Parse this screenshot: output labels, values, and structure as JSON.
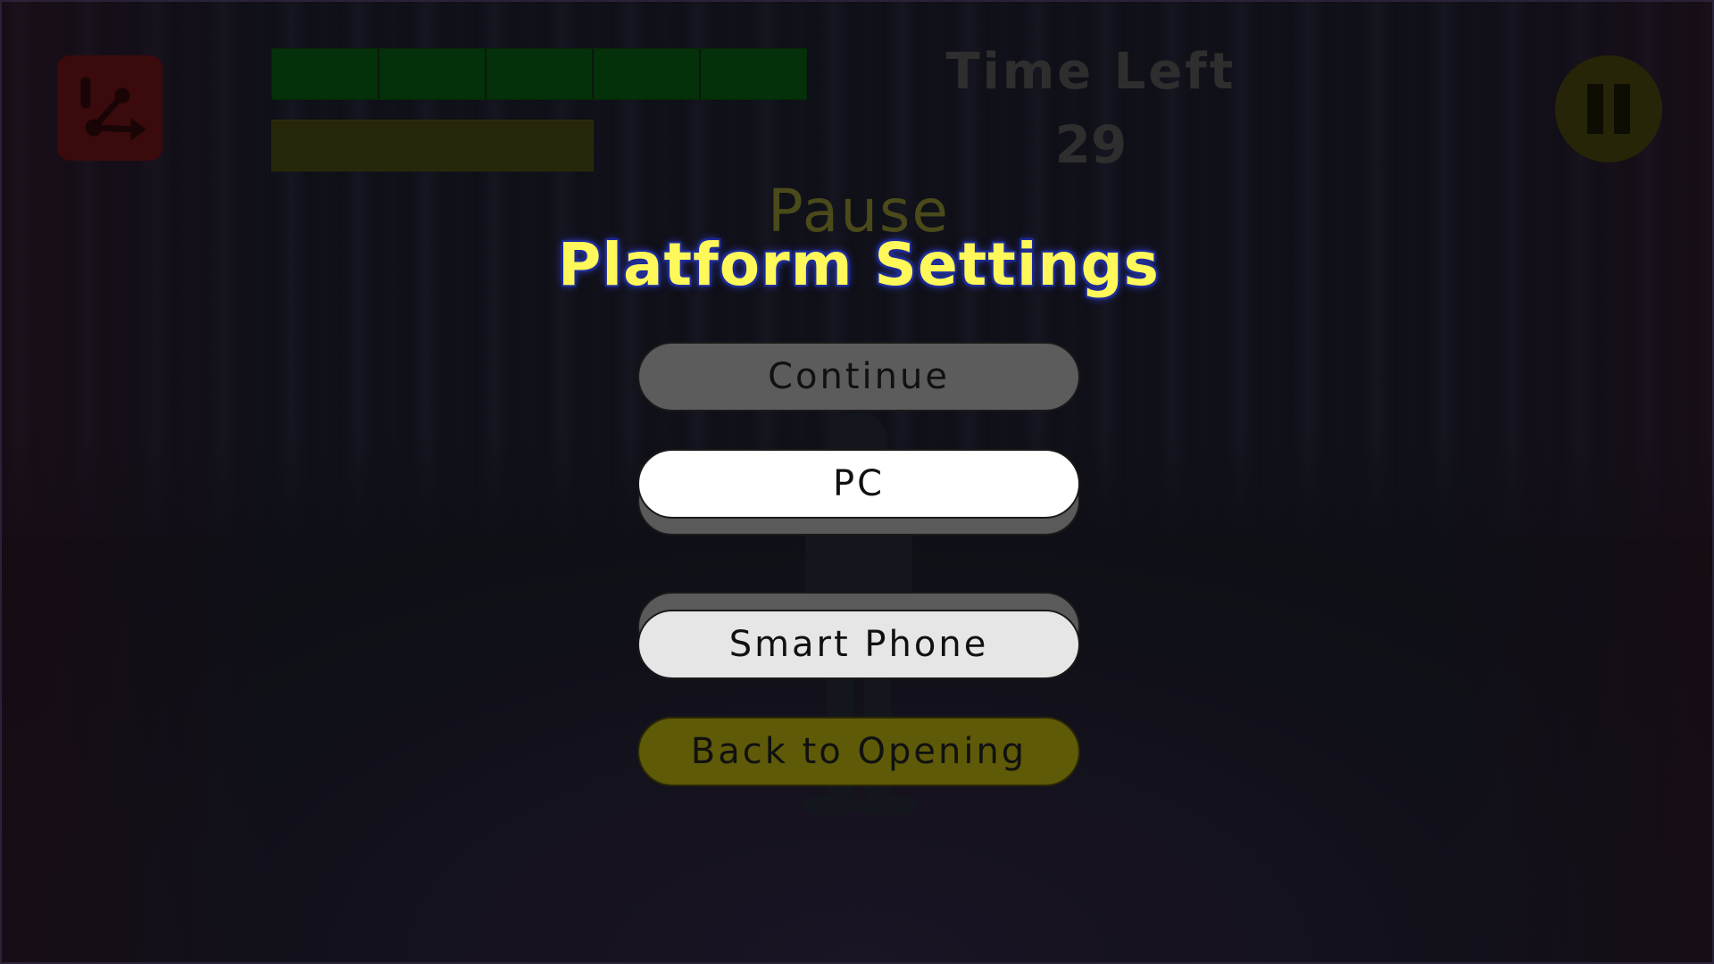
{
  "hud": {
    "health_segments": 5,
    "health_filled": 5,
    "power_level": 0.6,
    "time_label": "Time Left",
    "time_value": "29"
  },
  "menu": {
    "title": "Pause",
    "subtitle": "Platform Settings",
    "buttons": {
      "continue": "Continue",
      "pc": "PC",
      "smart_phone": "Smart Phone",
      "back": "Back to Opening"
    },
    "selected_platform": "PC"
  },
  "colors": {
    "title_yellow": "#fff85a",
    "title_outline": "#1c2a8a",
    "back_button": "#5e5a08",
    "health": "#04300a",
    "power": "#25260a",
    "share_red": "#3a0a0c"
  },
  "icons": {
    "share": "share-icon",
    "pause": "pause-icon"
  }
}
